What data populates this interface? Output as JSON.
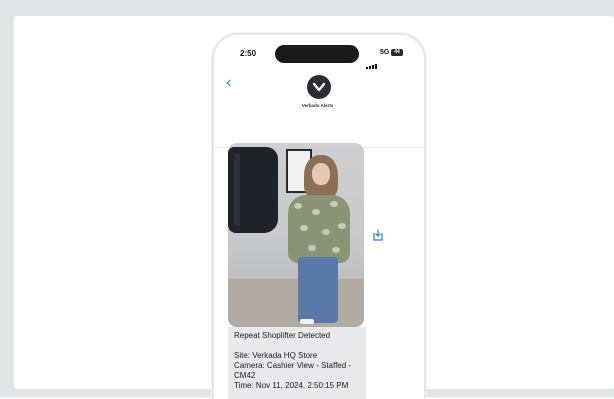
{
  "status_bar": {
    "time": "2:50",
    "network": "5G",
    "battery": "44"
  },
  "conversation": {
    "sender": "Verkada Alerts",
    "chevron": "›"
  },
  "message": {
    "line1": "Repeat Shoplifter Detected",
    "line2": "Site: Verkada HQ Store",
    "line3": "Camera: Cashier View - Staffed -",
    "line4": "CM42",
    "line5": "Time: Nov 11, 2024, 2:50:15 PM"
  },
  "icons": {
    "back": "chevron-left-icon",
    "logo": "verkada-check-icon",
    "save": "save-share-icon"
  },
  "colors": {
    "accent": "#2f7de1",
    "bubble": "#e9e9eb",
    "background": "#e3e4e6"
  }
}
